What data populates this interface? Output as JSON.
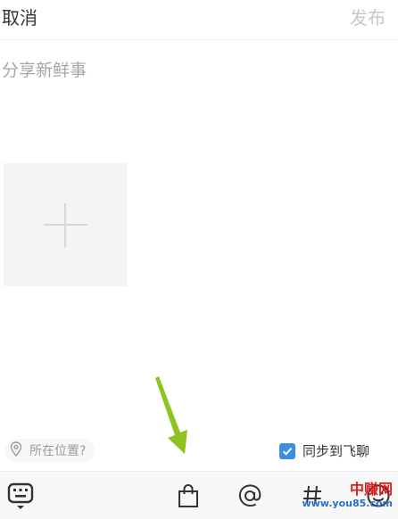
{
  "header": {
    "cancel_label": "取消",
    "publish_label": "发布"
  },
  "compose": {
    "placeholder": "分享新鲜事"
  },
  "footer": {
    "location_label": "所在位置?",
    "sync_label": "同步到飞聊",
    "sync_checked": true
  },
  "toolbar": {
    "icons": [
      "keyboard-icon",
      "shopping-bag-icon",
      "at-mention-icon",
      "hashtag-icon",
      "emoji-icon"
    ]
  },
  "watermark": {
    "name": "中赚网",
    "url": "www.you85.com"
  },
  "colors": {
    "accent": "#3d8ce6",
    "arrow": "#8fc31f",
    "watermark_red": "#d62020",
    "watermark_blue": "#2a6fc9"
  }
}
